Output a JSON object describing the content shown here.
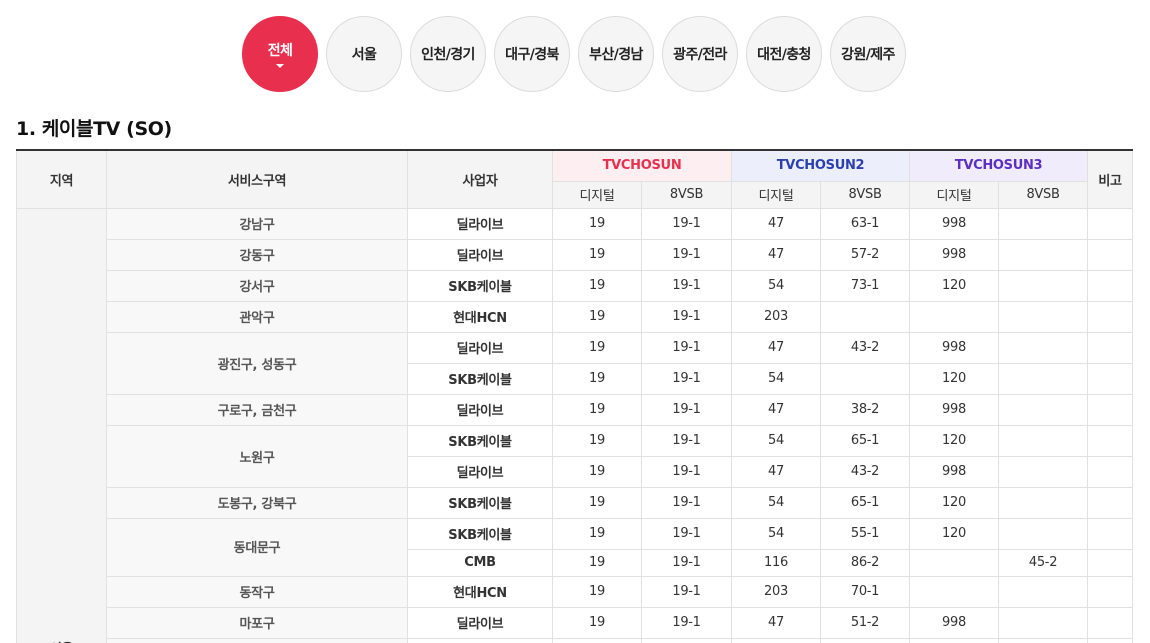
{
  "region_tabs": [
    {
      "label": "전체",
      "active": true
    },
    {
      "label": "서울",
      "active": false
    },
    {
      "label": "인천/경기",
      "active": false
    },
    {
      "label": "대구/경북",
      "active": false
    },
    {
      "label": "부산/경남",
      "active": false
    },
    {
      "label": "광주/전라",
      "active": false
    },
    {
      "label": "대전/충청",
      "active": false
    },
    {
      "label": "강원/제주",
      "active": false
    }
  ],
  "section_title": "1. 케이블TV (SO)",
  "table": {
    "headers": {
      "region": "지역",
      "service_area": "서비스구역",
      "operator": "사업자",
      "ch1": "TVCHOSUN",
      "ch2": "TVCHOSUN2",
      "ch3": "TVCHOSUN3",
      "note": "비고",
      "digital": "디지털",
      "vsb": "8VSB"
    },
    "region_name": "서울",
    "areas": [
      "강남구",
      "강동구",
      "강서구",
      "관악구",
      "광진구, 성동구",
      "구로구, 금천구",
      "노원구",
      "도봉구, 강북구",
      "동대문구",
      "동작구",
      "마포구"
    ],
    "rows": [
      {
        "op": "딜라이브",
        "c1d": "19",
        "c1v": "19-1",
        "c2d": "47",
        "c2v": "63-1",
        "c3d": "998",
        "c3v": "",
        "note": ""
      },
      {
        "op": "딜라이브",
        "c1d": "19",
        "c1v": "19-1",
        "c2d": "47",
        "c2v": "57-2",
        "c3d": "998",
        "c3v": "",
        "note": ""
      },
      {
        "op": "SKB케이블",
        "c1d": "19",
        "c1v": "19-1",
        "c2d": "54",
        "c2v": "73-1",
        "c3d": "120",
        "c3v": "",
        "note": ""
      },
      {
        "op": "현대HCN",
        "c1d": "19",
        "c1v": "19-1",
        "c2d": "203",
        "c2v": "",
        "c3d": "",
        "c3v": "",
        "note": ""
      },
      {
        "op": "딜라이브",
        "c1d": "19",
        "c1v": "19-1",
        "c2d": "47",
        "c2v": "43-2",
        "c3d": "998",
        "c3v": "",
        "note": ""
      },
      {
        "op": "SKB케이블",
        "c1d": "19",
        "c1v": "19-1",
        "c2d": "54",
        "c2v": "",
        "c3d": "120",
        "c3v": "",
        "note": ""
      },
      {
        "op": "딜라이브",
        "c1d": "19",
        "c1v": "19-1",
        "c2d": "47",
        "c2v": "38-2",
        "c3d": "998",
        "c3v": "",
        "note": ""
      },
      {
        "op": "SKB케이블",
        "c1d": "19",
        "c1v": "19-1",
        "c2d": "54",
        "c2v": "65-1",
        "c3d": "120",
        "c3v": "",
        "note": ""
      },
      {
        "op": "딜라이브",
        "c1d": "19",
        "c1v": "19-1",
        "c2d": "47",
        "c2v": "43-2",
        "c3d": "998",
        "c3v": "",
        "note": ""
      },
      {
        "op": "SKB케이블",
        "c1d": "19",
        "c1v": "19-1",
        "c2d": "54",
        "c2v": "65-1",
        "c3d": "120",
        "c3v": "",
        "note": ""
      },
      {
        "op": "SKB케이블",
        "c1d": "19",
        "c1v": "19-1",
        "c2d": "54",
        "c2v": "55-1",
        "c3d": "120",
        "c3v": "",
        "note": ""
      },
      {
        "op": "CMB",
        "c1d": "19",
        "c1v": "19-1",
        "c2d": "116",
        "c2v": "86-2",
        "c3d": "",
        "c3v": "45-2",
        "note": ""
      },
      {
        "op": "현대HCN",
        "c1d": "19",
        "c1v": "19-1",
        "c2d": "203",
        "c2v": "70-1",
        "c3d": "",
        "c3v": "",
        "note": ""
      },
      {
        "op": "딜라이브",
        "c1d": "19",
        "c1v": "19-1",
        "c2d": "47",
        "c2v": "51-2",
        "c3d": "998",
        "c3v": "",
        "note": ""
      }
    ]
  }
}
